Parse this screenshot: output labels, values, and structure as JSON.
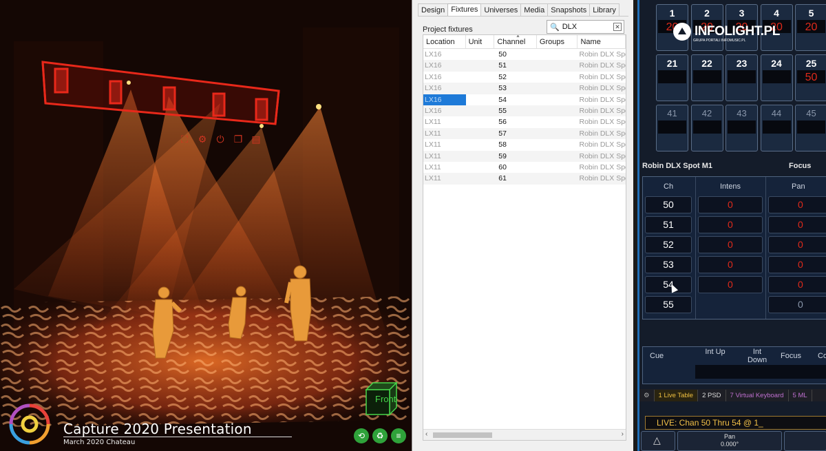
{
  "viewport": {
    "title": "Capture 2020 Presentation",
    "subtitle": "March 2020 Chateau",
    "view_cube_label": "Front",
    "rig_tools": [
      "fit-icon",
      "gear-icon",
      "power-icon",
      "copy-icon",
      "document-icon"
    ],
    "bottom_buttons": [
      "refresh-icon",
      "recycle-icon",
      "menu-icon"
    ],
    "colors": {
      "beam": "#ff6a1a",
      "rig": "#e8281a",
      "cube": "#46d64a",
      "button": "#2fa23a"
    }
  },
  "panel": {
    "tabs": [
      "Design",
      "Fixtures",
      "Universes",
      "Media",
      "Snapshots",
      "Library"
    ],
    "active_tab": "Fixtures",
    "section_label": "Project fixtures",
    "search_value": "DLX",
    "columns": [
      "Location",
      "Unit",
      "Channel",
      "Groups",
      "Name"
    ],
    "rows": [
      {
        "location": "LX16",
        "unit": "",
        "channel": "50",
        "groups": "",
        "name": "Robin DLX Spot"
      },
      {
        "location": "LX16",
        "unit": "",
        "channel": "51",
        "groups": "",
        "name": "Robin DLX Spot"
      },
      {
        "location": "LX16",
        "unit": "",
        "channel": "52",
        "groups": "",
        "name": "Robin DLX Spot"
      },
      {
        "location": "LX16",
        "unit": "",
        "channel": "53",
        "groups": "",
        "name": "Robin DLX Spot"
      },
      {
        "location": "LX16",
        "unit": "",
        "channel": "54",
        "groups": "",
        "name": "Robin DLX Spot",
        "selected": true
      },
      {
        "location": "LX16",
        "unit": "",
        "channel": "55",
        "groups": "",
        "name": "Robin DLX Spot"
      },
      {
        "location": "LX11",
        "unit": "",
        "channel": "56",
        "groups": "",
        "name": "Robin DLX Spot"
      },
      {
        "location": "LX11",
        "unit": "",
        "channel": "57",
        "groups": "",
        "name": "Robin DLX Spot"
      },
      {
        "location": "LX11",
        "unit": "",
        "channel": "58",
        "groups": "",
        "name": "Robin DLX Spot"
      },
      {
        "location": "LX11",
        "unit": "",
        "channel": "59",
        "groups": "",
        "name": "Robin DLX Spot"
      },
      {
        "location": "LX11",
        "unit": "",
        "channel": "60",
        "groups": "",
        "name": "Robin DLX Spot"
      },
      {
        "location": "LX11",
        "unit": "",
        "channel": "61",
        "groups": "",
        "name": "Robin DLX Spot"
      }
    ],
    "selection_color": "#1e7ad8"
  },
  "console": {
    "tiles": [
      {
        "num": "1",
        "val": "20"
      },
      {
        "num": "2",
        "val": "20"
      },
      {
        "num": "3",
        "val": "20"
      },
      {
        "num": "4",
        "val": "20"
      },
      {
        "num": "5",
        "val": "20"
      },
      {
        "num": "21",
        "val": ""
      },
      {
        "num": "22",
        "val": ""
      },
      {
        "num": "23",
        "val": ""
      },
      {
        "num": "24",
        "val": ""
      },
      {
        "num": "25",
        "val": "50"
      },
      {
        "num": "41",
        "val": ""
      },
      {
        "num": "42",
        "val": ""
      },
      {
        "num": "43",
        "val": ""
      },
      {
        "num": "44",
        "val": ""
      },
      {
        "num": "45",
        "val": ""
      }
    ],
    "fixture_name": "Robin DLX Spot M1",
    "focus_label": "Focus",
    "table_headers": [
      "Ch",
      "Intens",
      "Pan"
    ],
    "channels": [
      {
        "ch": "50",
        "intens": "0",
        "pan": "0"
      },
      {
        "ch": "51",
        "intens": "0",
        "pan": "0"
      },
      {
        "ch": "52",
        "intens": "0",
        "pan": "0"
      },
      {
        "ch": "53",
        "intens": "0",
        "pan": "0"
      },
      {
        "ch": "54",
        "intens": "0",
        "pan": "0"
      },
      {
        "ch": "55",
        "intens": "",
        "pan": "0"
      }
    ],
    "cue_headers": [
      "Cue",
      "Int Up",
      "Int Down",
      "Focus",
      "Co"
    ],
    "tabs": [
      "1 Live Table",
      "2 PSD",
      "7 Virtual Keyboard",
      "5 ML"
    ],
    "command_line": "LIVE:  Chan 50 Thru 54 @ 1_",
    "pan_label": "Pan",
    "pan_value": "0.000°",
    "watermark": "INFOLIGHT.PL",
    "watermark_sub": "GRUPA PORTALI INFOMUSIC.PL",
    "colors": {
      "value_red": "#e02a1a",
      "command_amber": "#f2c048"
    }
  }
}
